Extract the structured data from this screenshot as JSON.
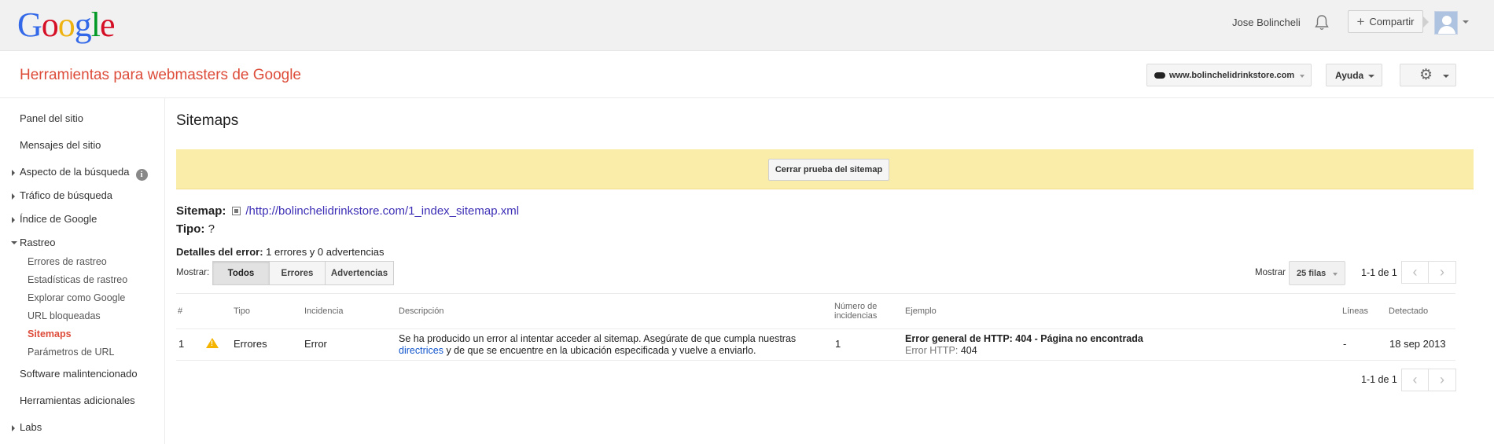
{
  "header": {
    "logo_letters": [
      {
        "ch": "G",
        "color": "#3369e8"
      },
      {
        "ch": "o",
        "color": "#d50f25"
      },
      {
        "ch": "o",
        "color": "#eeb211"
      },
      {
        "ch": "g",
        "color": "#3369e8"
      },
      {
        "ch": "l",
        "color": "#009925"
      },
      {
        "ch": "e",
        "color": "#d50f25"
      }
    ],
    "user_name": "Jose Bolincheli",
    "share_label": "Compartir",
    "app_title": "Herramientas para webmasters de Google",
    "site": "www.bolinchelidrinkstore.com",
    "help": "Ayuda"
  },
  "sidebar": {
    "items": [
      {
        "label": "Panel del sitio"
      },
      {
        "label": "Mensajes del sitio"
      },
      {
        "label": "Aspecto de la búsqueda"
      },
      {
        "label": "Tráfico de búsqueda"
      },
      {
        "label": "Índice de Google"
      },
      {
        "label": "Rastreo"
      },
      {
        "label": "Software malintencionado"
      },
      {
        "label": "Herramientas adicionales"
      },
      {
        "label": "Labs"
      }
    ],
    "subitems": [
      {
        "label": "Errores de rastreo"
      },
      {
        "label": "Estadísticas de rastreo"
      },
      {
        "label": "Explorar como Google"
      },
      {
        "label": "URL bloqueadas"
      },
      {
        "label": "Sitemaps"
      },
      {
        "label": "Parámetros de URL"
      }
    ],
    "info_glyph": "i"
  },
  "main": {
    "title": "Sitemaps",
    "banner_button": "Cerrar prueba del sitemap",
    "sitemap_label": "Sitemap:",
    "sitemap_url": "/http://bolinchelidrinkstore.com/1_index_sitemap.xml",
    "type_label": "Tipo:",
    "type_value": "?",
    "error_details_label": "Detalles del error:",
    "error_details_value": "1 errores y 0 advertencias",
    "show_label": "Mostrar:",
    "filters": [
      "Todos",
      "Errores",
      "Advertencias"
    ],
    "rows_label": "Mostrar",
    "rows_value": "25 filas",
    "pager": "1-1 de 1",
    "columns": [
      "#",
      "Tipo",
      "Incidencia",
      "Descripción",
      "Número de",
      "incidencias",
      "Ejemplo",
      "Líneas",
      "Detectado"
    ],
    "row": {
      "num": "1",
      "type": "Errores",
      "incidence": "Error",
      "desc_1": "Se ha producido un error al intentar acceder al sitemap. Asegúrate de que cumpla nuestras",
      "desc_link": "directrices",
      "desc_2": " y de que se encuentre en la ubicación especificada y vuelve a enviarlo.",
      "count": "1",
      "example_title": "Error general de HTTP: 404 - Página no encontrada",
      "example_sub_label": "Error HTTP:",
      "example_sub_value": "404",
      "lines": "-",
      "detected": "18 sep 2013"
    }
  }
}
